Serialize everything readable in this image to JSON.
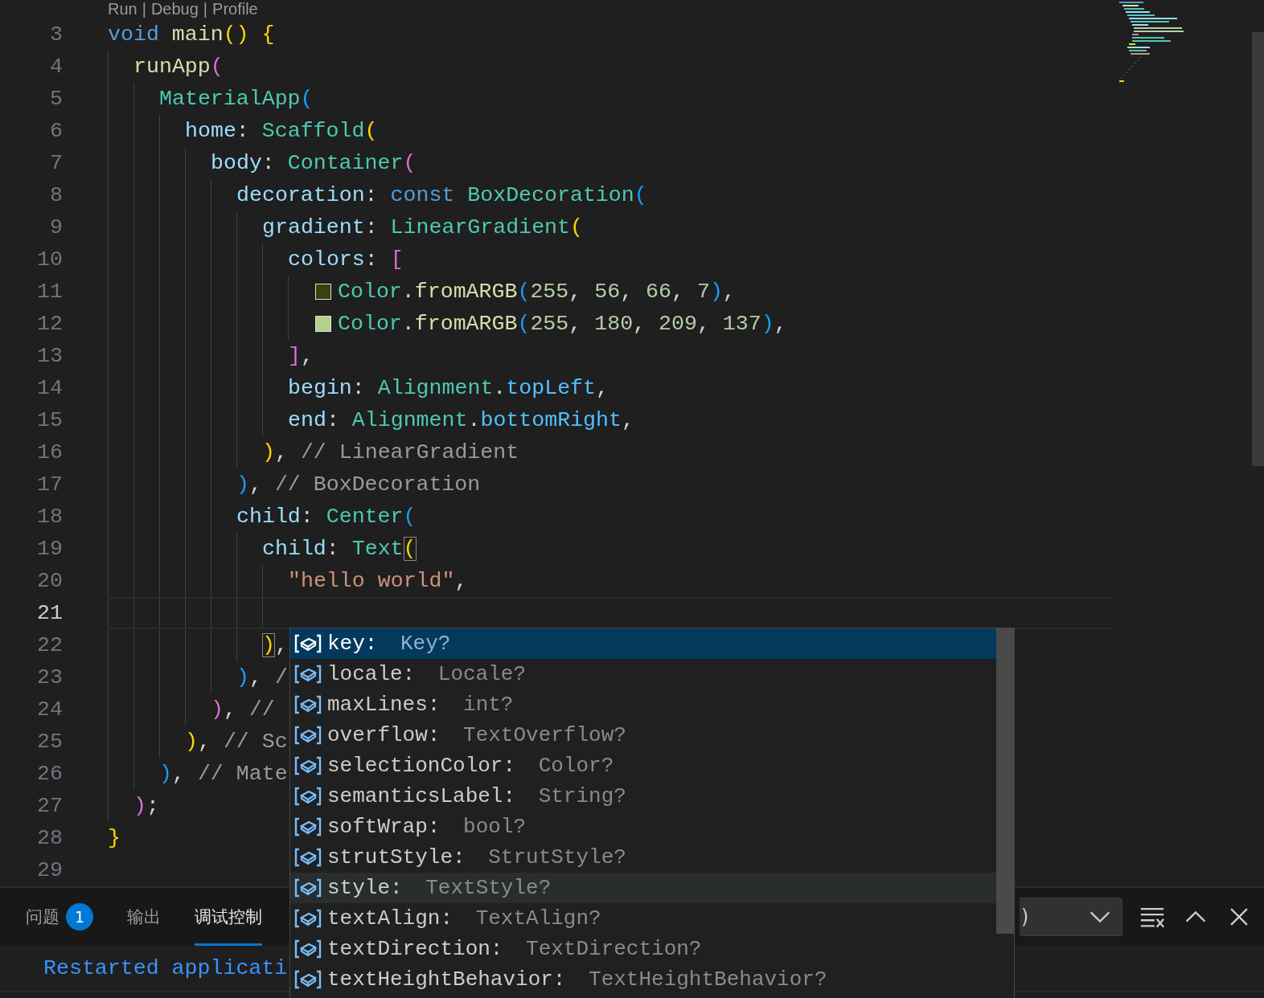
{
  "codelens": {
    "items": [
      "Run",
      "Debug",
      "Profile"
    ],
    "separator": "|"
  },
  "lines": [
    {
      "number": "3",
      "current": false,
      "tokens": [
        {
          "kind": "kw",
          "text": "void "
        },
        {
          "kind": "fn",
          "text": "main"
        },
        {
          "kind": "b1",
          "text": "() {"
        }
      ],
      "children": [
        {
          "number": "4",
          "current": false,
          "tokens": [
            {
              "kind": "fn",
              "text": "runApp"
            },
            {
              "kind": "b2",
              "text": "("
            }
          ],
          "children": [
            {
              "number": "5",
              "current": false,
              "tokens": [
                {
                  "kind": "cls",
                  "text": "MaterialApp"
                },
                {
                  "kind": "b3",
                  "text": "("
                }
              ],
              "children": [
                {
                  "number": "6",
                  "current": false,
                  "tokens": [
                    {
                      "kind": "prop",
                      "text": "home"
                    },
                    {
                      "kind": "punct",
                      "text": ": "
                    },
                    {
                      "kind": "cls",
                      "text": "Scaffold"
                    },
                    {
                      "kind": "b1",
                      "text": "("
                    }
                  ],
                  "children": [
                    {
                      "number": "7",
                      "current": false,
                      "tokens": [
                        {
                          "kind": "prop",
                          "text": "body"
                        },
                        {
                          "kind": "punct",
                          "text": ": "
                        },
                        {
                          "kind": "cls",
                          "text": "Container"
                        },
                        {
                          "kind": "b2",
                          "text": "("
                        }
                      ],
                      "children": [
                        {
                          "number": "8",
                          "current": false,
                          "tokens": [
                            {
                              "kind": "prop",
                              "text": "decoration"
                            },
                            {
                              "kind": "punct",
                              "text": ": "
                            },
                            {
                              "kind": "kw",
                              "text": "const "
                            },
                            {
                              "kind": "cls",
                              "text": "BoxDecoration"
                            },
                            {
                              "kind": "b3",
                              "text": "("
                            }
                          ],
                          "children": [
                            {
                              "number": "9",
                              "current": false,
                              "tokens": [
                                {
                                  "kind": "prop",
                                  "text": "gradient"
                                },
                                {
                                  "kind": "punct",
                                  "text": ": "
                                },
                                {
                                  "kind": "cls",
                                  "text": "LinearGradient"
                                },
                                {
                                  "kind": "b1",
                                  "text": "("
                                }
                              ],
                              "children": [
                                {
                                  "number": "10",
                                  "current": false,
                                  "tokens": [
                                    {
                                      "kind": "prop",
                                      "text": "colors"
                                    },
                                    {
                                      "kind": "punct",
                                      "text": ": "
                                    },
                                    {
                                      "kind": "b2",
                                      "text": "["
                                    }
                                  ],
                                  "children": [
                                    {
                                      "number": "11",
                                      "current": false,
                                      "tokens": [
                                        {
                                          "kind": "swatch",
                                          "color": "#38420a"
                                        },
                                        {
                                          "kind": "cls",
                                          "text": "Color"
                                        },
                                        {
                                          "kind": "punct",
                                          "text": "."
                                        },
                                        {
                                          "kind": "fn",
                                          "text": "fromARGB"
                                        },
                                        {
                                          "kind": "b3",
                                          "text": "("
                                        },
                                        {
                                          "kind": "num",
                                          "text": "255"
                                        },
                                        {
                                          "kind": "punct",
                                          "text": ", "
                                        },
                                        {
                                          "kind": "num",
                                          "text": "56"
                                        },
                                        {
                                          "kind": "punct",
                                          "text": ", "
                                        },
                                        {
                                          "kind": "num",
                                          "text": "66"
                                        },
                                        {
                                          "kind": "punct",
                                          "text": ", "
                                        },
                                        {
                                          "kind": "num",
                                          "text": "7"
                                        },
                                        {
                                          "kind": "b3",
                                          "text": ")"
                                        },
                                        {
                                          "kind": "punct",
                                          "text": ","
                                        }
                                      ]
                                    },
                                    {
                                      "number": "12",
                                      "current": false,
                                      "tokens": [
                                        {
                                          "kind": "swatch",
                                          "color": "#b4d189"
                                        },
                                        {
                                          "kind": "cls",
                                          "text": "Color"
                                        },
                                        {
                                          "kind": "punct",
                                          "text": "."
                                        },
                                        {
                                          "kind": "fn",
                                          "text": "fromARGB"
                                        },
                                        {
                                          "kind": "b3",
                                          "text": "("
                                        },
                                        {
                                          "kind": "num",
                                          "text": "255"
                                        },
                                        {
                                          "kind": "punct",
                                          "text": ", "
                                        },
                                        {
                                          "kind": "num",
                                          "text": "180"
                                        },
                                        {
                                          "kind": "punct",
                                          "text": ", "
                                        },
                                        {
                                          "kind": "num",
                                          "text": "209"
                                        },
                                        {
                                          "kind": "punct",
                                          "text": ", "
                                        },
                                        {
                                          "kind": "num",
                                          "text": "137"
                                        },
                                        {
                                          "kind": "b3",
                                          "text": ")"
                                        },
                                        {
                                          "kind": "punct",
                                          "text": ","
                                        }
                                      ]
                                    }
                                  ]
                                },
                                {
                                  "number": "13",
                                  "current": false,
                                  "tokens": [
                                    {
                                      "kind": "b2",
                                      "text": "]"
                                    },
                                    {
                                      "kind": "punct",
                                      "text": ","
                                    }
                                  ]
                                },
                                {
                                  "number": "14",
                                  "current": false,
                                  "tokens": [
                                    {
                                      "kind": "prop",
                                      "text": "begin"
                                    },
                                    {
                                      "kind": "punct",
                                      "text": ": "
                                    },
                                    {
                                      "kind": "cls",
                                      "text": "Alignment"
                                    },
                                    {
                                      "kind": "punct",
                                      "text": "."
                                    },
                                    {
                                      "kind": "const",
                                      "text": "topLeft"
                                    },
                                    {
                                      "kind": "punct",
                                      "text": ","
                                    }
                                  ]
                                },
                                {
                                  "number": "15",
                                  "current": false,
                                  "tokens": [
                                    {
                                      "kind": "prop",
                                      "text": "end"
                                    },
                                    {
                                      "kind": "punct",
                                      "text": ": "
                                    },
                                    {
                                      "kind": "cls",
                                      "text": "Alignment"
                                    },
                                    {
                                      "kind": "punct",
                                      "text": "."
                                    },
                                    {
                                      "kind": "const",
                                      "text": "bottomRight"
                                    },
                                    {
                                      "kind": "punct",
                                      "text": ","
                                    }
                                  ]
                                }
                              ]
                            },
                            {
                              "number": "16",
                              "current": false,
                              "tokens": [
                                {
                                  "kind": "b1",
                                  "text": ")"
                                },
                                {
                                  "kind": "punct",
                                  "text": ", "
                                },
                                {
                                  "kind": "comment",
                                  "text": "// LinearGradient"
                                }
                              ]
                            }
                          ]
                        },
                        {
                          "number": "17",
                          "current": false,
                          "tokens": [
                            {
                              "kind": "b3",
                              "text": ")"
                            },
                            {
                              "kind": "punct",
                              "text": ", "
                            },
                            {
                              "kind": "comment",
                              "text": "// BoxDecoration"
                            }
                          ]
                        },
                        {
                          "number": "18",
                          "current": false,
                          "tokens": [
                            {
                              "kind": "prop",
                              "text": "child"
                            },
                            {
                              "kind": "punct",
                              "text": ": "
                            },
                            {
                              "kind": "cls",
                              "text": "Center"
                            },
                            {
                              "kind": "b3",
                              "text": "("
                            }
                          ],
                          "children": [
                            {
                              "number": "19",
                              "current": false,
                              "tokens": [
                                {
                                  "kind": "prop",
                                  "text": "child"
                                },
                                {
                                  "kind": "punct",
                                  "text": ": "
                                },
                                {
                                  "kind": "cls",
                                  "text": "Text"
                                },
                                {
                                  "kind": "match",
                                  "text": "("
                                }
                              ],
                              "children": [
                                {
                                  "number": "20",
                                  "current": false,
                                  "tokens": [
                                    {
                                      "kind": "str",
                                      "text": "\"hello world\""
                                    },
                                    {
                                      "kind": "punct",
                                      "text": ","
                                    }
                                  ]
                                },
                                {
                                  "number": "21",
                                  "current": true
                                }
                              ]
                            },
                            {
                              "number": "22",
                              "current": false,
                              "tokens": [
                                {
                                  "kind": "match",
                                  "text": ")"
                                },
                                {
                                  "kind": "punct",
                                  "text": ","
                                }
                              ]
                            }
                          ]
                        },
                        {
                          "number": "23",
                          "current": false,
                          "tokens": [
                            {
                              "kind": "b3",
                              "text": ")"
                            },
                            {
                              "kind": "punct",
                              "text": ", "
                            },
                            {
                              "kind": "comment",
                              "text": "/"
                            }
                          ]
                        }
                      ]
                    },
                    {
                      "number": "24",
                      "current": false,
                      "tokens": [
                        {
                          "kind": "b2",
                          "text": ")"
                        },
                        {
                          "kind": "punct",
                          "text": ", "
                        },
                        {
                          "kind": "comment",
                          "text": "//"
                        }
                      ]
                    }
                  ]
                },
                {
                  "number": "25",
                  "current": false,
                  "tokens": [
                    {
                      "kind": "b1",
                      "text": ")"
                    },
                    {
                      "kind": "punct",
                      "text": ", "
                    },
                    {
                      "kind": "comment",
                      "text": "// Sc"
                    }
                  ]
                }
              ]
            },
            {
              "number": "26",
              "current": false,
              "tokens": [
                {
                  "kind": "b3",
                  "text": ")"
                },
                {
                  "kind": "punct",
                  "text": ", "
                },
                {
                  "kind": "comment",
                  "text": "// Mate"
                }
              ]
            }
          ]
        },
        {
          "number": "27",
          "current": false,
          "tokens": [
            {
              "kind": "b2",
              "text": ")"
            },
            {
              "kind": "punct",
              "text": ";"
            }
          ]
        }
      ]
    },
    {
      "number": "28",
      "current": false,
      "tokens": [
        {
          "kind": "b1",
          "text": "}"
        }
      ]
    },
    {
      "number": "29",
      "current": false
    }
  ],
  "suggestions": [
    {
      "label": "key:",
      "type": "Key?",
      "selected": true,
      "hovered": false
    },
    {
      "label": "locale:",
      "type": "Locale?",
      "selected": false,
      "hovered": false
    },
    {
      "label": "maxLines:",
      "type": "int?",
      "selected": false,
      "hovered": false
    },
    {
      "label": "overflow:",
      "type": "TextOverflow?",
      "selected": false,
      "hovered": false
    },
    {
      "label": "selectionColor:",
      "type": "Color?",
      "selected": false,
      "hovered": false
    },
    {
      "label": "semanticsLabel:",
      "type": "String?",
      "selected": false,
      "hovered": false
    },
    {
      "label": "softWrap:",
      "type": "bool?",
      "selected": false,
      "hovered": false
    },
    {
      "label": "strutStyle:",
      "type": "StrutStyle?",
      "selected": false,
      "hovered": false
    },
    {
      "label": "style:",
      "type": "TextStyle?",
      "selected": false,
      "hovered": true
    },
    {
      "label": "textAlign:",
      "type": "TextAlign?",
      "selected": false,
      "hovered": false
    },
    {
      "label": "textDirection:",
      "type": "TextDirection?",
      "selected": false,
      "hovered": false
    },
    {
      "label": "textHeightBehavior:",
      "type": "TextHeightBehavior?",
      "selected": false,
      "hovered": false
    }
  ],
  "panel": {
    "tabs": [
      {
        "label": "问题",
        "badge": "1",
        "selected": false
      },
      {
        "label": "输出",
        "selected": false
      },
      {
        "label": "调试控制",
        "selected": true
      }
    ],
    "dropdown": {
      "value": ")"
    },
    "output": [
      "Restarted applicati"
    ]
  }
}
